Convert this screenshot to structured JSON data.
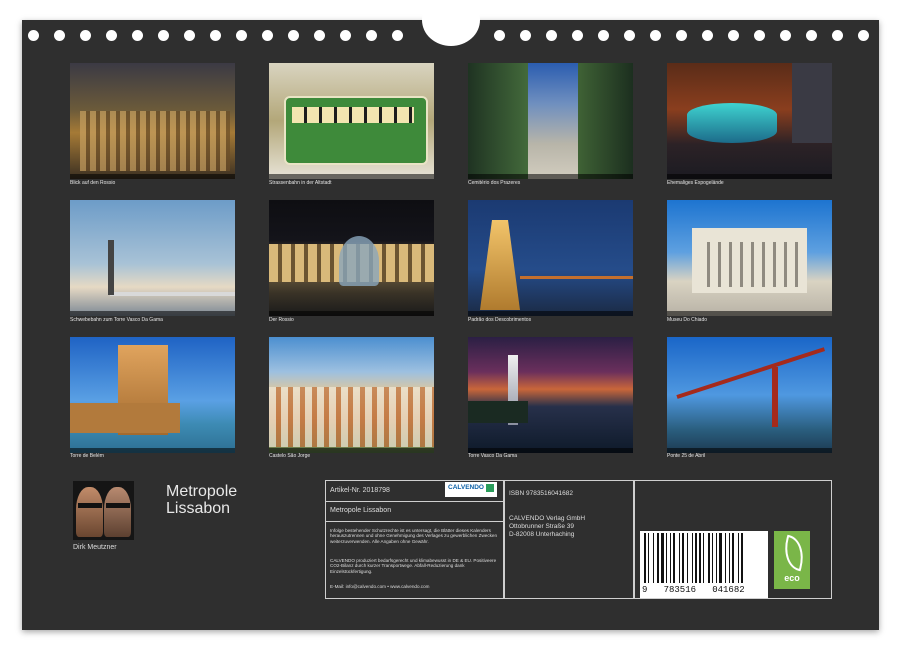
{
  "thumbnails": [
    {
      "caption": "Blick auf den Rossio"
    },
    {
      "caption": "Strassenbahn in der Altstadt"
    },
    {
      "caption": "Cemitério dos Prazeres"
    },
    {
      "caption": "Ehemaliges Expogelände"
    },
    {
      "caption": "Schwebebahn zum Torre Vasco Da Gama"
    },
    {
      "caption": "Der Rossio"
    },
    {
      "caption": "Padrão dos Descobrimentos"
    },
    {
      "caption": "Museu Do Chiado"
    },
    {
      "caption": "Torre de Belém"
    },
    {
      "caption": "Castelo São Jorge"
    },
    {
      "caption": "Torre Vasco Da Gama"
    },
    {
      "caption": "Ponte 25 de Abril"
    }
  ],
  "title_line1": "Metropole",
  "title_line2": "Lissabon",
  "author": "Dirk Meutzner",
  "article": "Artikel-Nr. 2018798",
  "product_title": "Metropole Lissabon",
  "logo": "CALVENDO",
  "legal_1": "Infolge bestehender Schutzrechte ist es untersagt, die Blätter dieses Kalenders herauszutrennen und ohne Genehmigung des Verlages zu gewerblichen Zwecken weiterzuverwenden. Alle Angaben ohne Gewähr.",
  "legal_2": "CALVENDO produziert bedarfsgerecht und klimabewusst in DE & EU. Positiveere CO2-Bilanz durch kurzer Transportwege. Abfall-Reduzierung dank Einzelstückfertigung.",
  "email": "E-Mail: info@calvendo.com • www.calvendo.com",
  "isbn": "ISBN 9783516041682",
  "publisher_1": "CALVENDO Verlag GmbH",
  "publisher_2": "Ottobrunner Straße 39",
  "publisher_3": "D-82008 Unterhaching",
  "barcode_digits": "9   783516   041682",
  "eco_label": "eco",
  "colors": {
    "panel": "#2f2f2f",
    "eco_green": "#7ab648"
  }
}
